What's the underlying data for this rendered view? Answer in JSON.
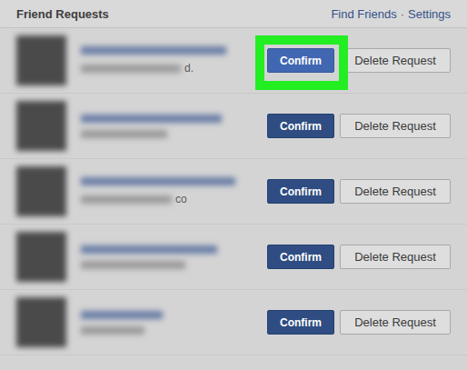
{
  "panel": {
    "title": "Friend Requests",
    "links": [
      "Find Friends",
      "Settings"
    ],
    "separator": "·"
  },
  "requests": [
    {
      "name_tail": "d.",
      "confirm": "Confirm",
      "delete": "Delete Request",
      "highlighted": true
    },
    {
      "name_tail": "",
      "confirm": "Confirm",
      "delete": "Delete Request",
      "highlighted": false
    },
    {
      "name_tail": "co",
      "confirm": "Confirm",
      "delete": "Delete Request",
      "highlighted": false
    },
    {
      "name_tail": "",
      "confirm": "Confirm",
      "delete": "Delete Request",
      "highlighted": false
    },
    {
      "name_tail": "",
      "confirm": "Confirm",
      "delete": "Delete Request",
      "highlighted": false
    }
  ]
}
